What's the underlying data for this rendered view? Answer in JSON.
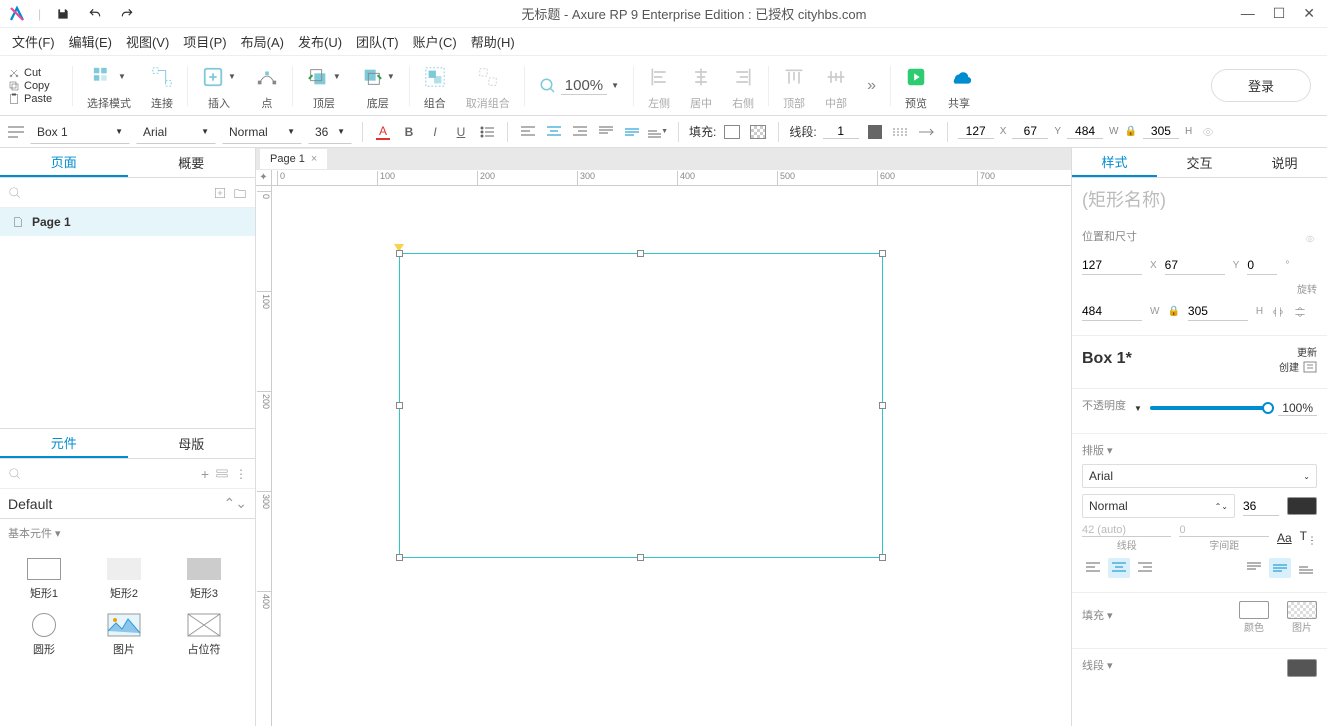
{
  "title": "无标题 - Axure RP 9 Enterprise Edition : 已授权     cityhbs.com",
  "clipboard": {
    "cut": "Cut",
    "copy": "Copy",
    "paste": "Paste"
  },
  "menu": [
    "文件(F)",
    "编辑(E)",
    "视图(V)",
    "项目(P)",
    "布局(A)",
    "发布(U)",
    "团队(T)",
    "账户(C)",
    "帮助(H)"
  ],
  "toolbar": {
    "select_mode": "选择模式",
    "connect": "连接",
    "insert": "插入",
    "point": "点",
    "top_layer": "顶层",
    "bottom_layer": "底层",
    "group": "组合",
    "ungroup": "取消组合",
    "zoom": "100%",
    "align_left": "左侧",
    "align_center": "居中",
    "align_right": "右侧",
    "align_top": "顶部",
    "align_middle": "中部",
    "preview": "预览",
    "share": "共享",
    "login": "登录"
  },
  "format": {
    "shape_type": "Box 1",
    "font": "Arial",
    "weight": "Normal",
    "size": "36",
    "fill_label": "填充:",
    "line_label": "线段:",
    "line_width": "1",
    "x": "127",
    "y": "67",
    "w": "484",
    "h": "305"
  },
  "pages": {
    "tab_pages": "页面",
    "tab_outline": "概要",
    "page1": "Page 1"
  },
  "elements": {
    "tab_lib": "元件",
    "tab_master": "母版",
    "category": "Default",
    "basic_title": "基本元件",
    "items": [
      "矩形1",
      "矩形2",
      "矩形3",
      "圆形",
      "图片",
      "占位符"
    ]
  },
  "canvas": {
    "tab": "Page 1",
    "ruler_h": [
      "0",
      "100",
      "200",
      "300",
      "400",
      "500",
      "600",
      "700"
    ],
    "ruler_v": [
      "0",
      "100",
      "200",
      "300",
      "400"
    ]
  },
  "inspector": {
    "tab_style": "样式",
    "tab_interact": "交互",
    "tab_notes": "说明",
    "shape_name_placeholder": "(矩形名称)",
    "pos_size": "位置和尺寸",
    "x": "127",
    "y": "67",
    "rot": "0",
    "rot_lbl": "旋转",
    "w": "484",
    "h": "305",
    "style_name": "Box 1*",
    "update": "更新",
    "create": "创建",
    "opacity_lbl": "不透明度",
    "opacity_val": "100%",
    "typo_title": "排版",
    "font": "Arial",
    "weight": "Normal",
    "size": "36",
    "line_h": "42 (auto)",
    "line_h_lbl": "线段",
    "char_sp": "0",
    "char_sp_lbl": "字间距",
    "fill_title": "填充",
    "fill_color": "颜色",
    "fill_image": "图片",
    "line_title": "线段"
  }
}
